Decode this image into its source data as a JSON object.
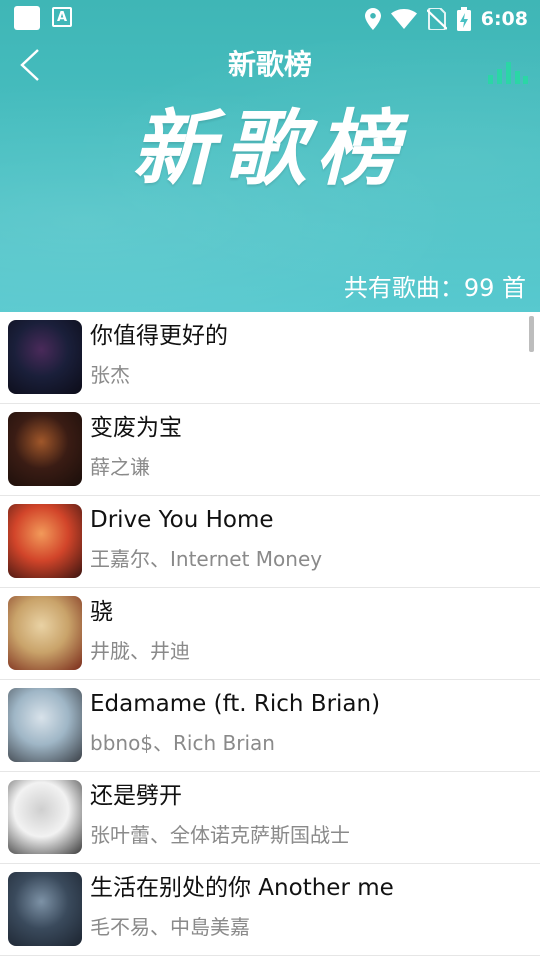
{
  "status_bar": {
    "time": "6:08",
    "left_icons": [
      "notification-square-icon",
      "app-a-icon"
    ],
    "right_icons": [
      "location-icon",
      "wifi-icon",
      "no-sim-icon",
      "battery-charging-icon"
    ]
  },
  "header": {
    "title": "新歌榜",
    "banner_text": "新歌榜",
    "song_count": "共有歌曲：99 首",
    "accent_color": "#2bd6a6",
    "background_color": "#49c0c3"
  },
  "songs": [
    {
      "title": "你值得更好的",
      "artist": "张杰",
      "cover_colors": [
        "#1a1f3a",
        "#4a2a5a",
        "#0c0c18"
      ]
    },
    {
      "title": "变废为宝",
      "artist": "薛之谦",
      "cover_colors": [
        "#3a1c14",
        "#a0572a",
        "#1a0e0a"
      ]
    },
    {
      "title": "Drive You Home",
      "artist": "王嘉尔、Internet Money",
      "cover_colors": [
        "#d2452a",
        "#f29a5a",
        "#3a1410"
      ]
    },
    {
      "title": "骁",
      "artist": "井胧、井迪",
      "cover_colors": [
        "#c9a36a",
        "#e9d2a4",
        "#7a2a1a"
      ]
    },
    {
      "title": "Edamame (ft. Rich Brian)",
      "artist": "bbno$、Rich Brian",
      "cover_colors": [
        "#9fb6c6",
        "#d8e2ea",
        "#3a3f46"
      ]
    },
    {
      "title": "还是劈开",
      "artist": "张叶蕾、全体诺克萨斯国战士",
      "cover_colors": [
        "#f2f2f2",
        "#cfcfcf",
        "#3a3a3a"
      ]
    },
    {
      "title": "生活在别处的你 Another me",
      "artist": "毛不易、中島美嘉",
      "cover_colors": [
        "#3a4a5c",
        "#7d92a6",
        "#1c2430"
      ]
    }
  ]
}
